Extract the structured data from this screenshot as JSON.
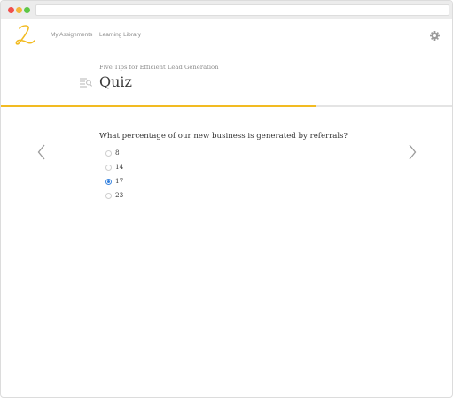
{
  "nav": {
    "items": [
      {
        "label": "My Assignments"
      },
      {
        "label": "Learning Library"
      }
    ]
  },
  "header": {
    "course_title": "Five Tips for Efficient Lead Generation",
    "page_title": "Quiz"
  },
  "progress": {
    "fraction": 0.7
  },
  "quiz": {
    "question": "What percentage of our new business is generated by referrals?",
    "options": [
      {
        "label": "8",
        "selected": false
      },
      {
        "label": "14",
        "selected": false
      },
      {
        "label": "17",
        "selected": true
      },
      {
        "label": "23",
        "selected": false
      }
    ]
  },
  "colors": {
    "accent": "#f2bb22",
    "radio_selected": "#2f7fe0",
    "nav_text": "#8b8b8b"
  },
  "icons": {
    "logo": "cursive-l-logo",
    "settings": "gear-icon",
    "quiz": "quiz-list-icon",
    "prev": "chevron-left-icon",
    "next": "chevron-right-icon"
  }
}
